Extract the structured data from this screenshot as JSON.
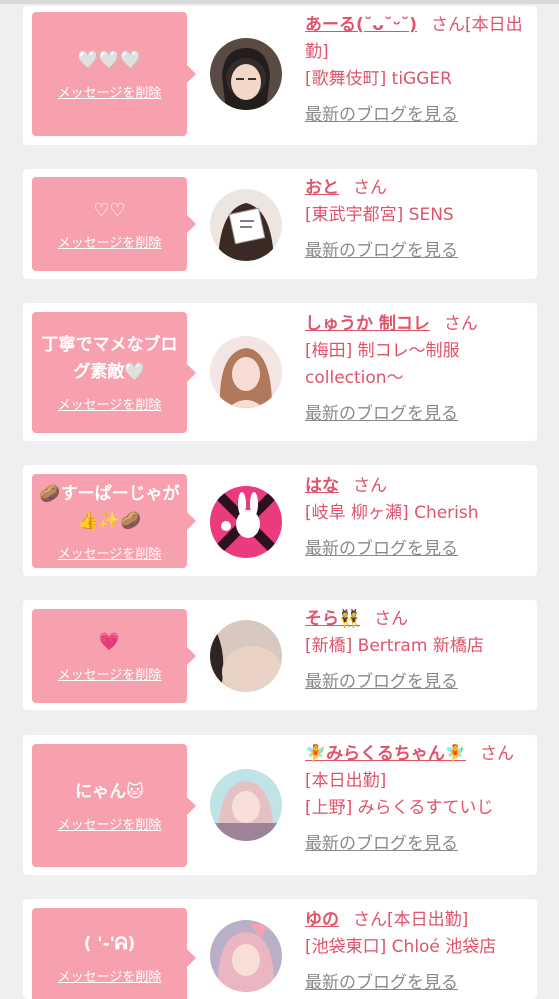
{
  "common": {
    "delete_label": "メッセージを削除",
    "blog_label": "最新のブログを見る",
    "honorific": "さん"
  },
  "items": [
    {
      "message": "🤍🤍🤍",
      "name": "あーる(˘ᴗ˘ᵕ˘)",
      "status": "[本日出勤]",
      "shop": "[歌舞伎町] tiGGER"
    },
    {
      "message": "♡♡",
      "name": "おと",
      "status": "",
      "shop": "[東武宇都宮] SENS"
    },
    {
      "message": "丁寧でマメなブログ素敵🤍",
      "name": "しゅうか 制コレ",
      "status": "",
      "shop": "[梅田] 制コレ〜制服collection〜"
    },
    {
      "message": "🥔すーぱーじゃが👍✨🥔",
      "name": "はな",
      "status": "",
      "shop": "[岐阜 柳ヶ瀬] Cherish"
    },
    {
      "message": "💗",
      "name": "そら👯",
      "status": "",
      "shop": "[新橋] Bertram 新橋店"
    },
    {
      "message": "にゃん🐱",
      "name": "🧚みらくるちゃん🧚",
      "status": "[本日出勤]",
      "shop": "[上野] みらくるすていじ"
    },
    {
      "message": "( '-'ᕱ)",
      "name": "ゆの",
      "status": "[本日出勤]",
      "shop": "[池袋東口] Chloé 池袋店"
    }
  ],
  "colors": {
    "accent": "#e0536a",
    "bubble": "#f8a1ae",
    "link_gray": "#8a8a8a",
    "background": "#efefef"
  }
}
